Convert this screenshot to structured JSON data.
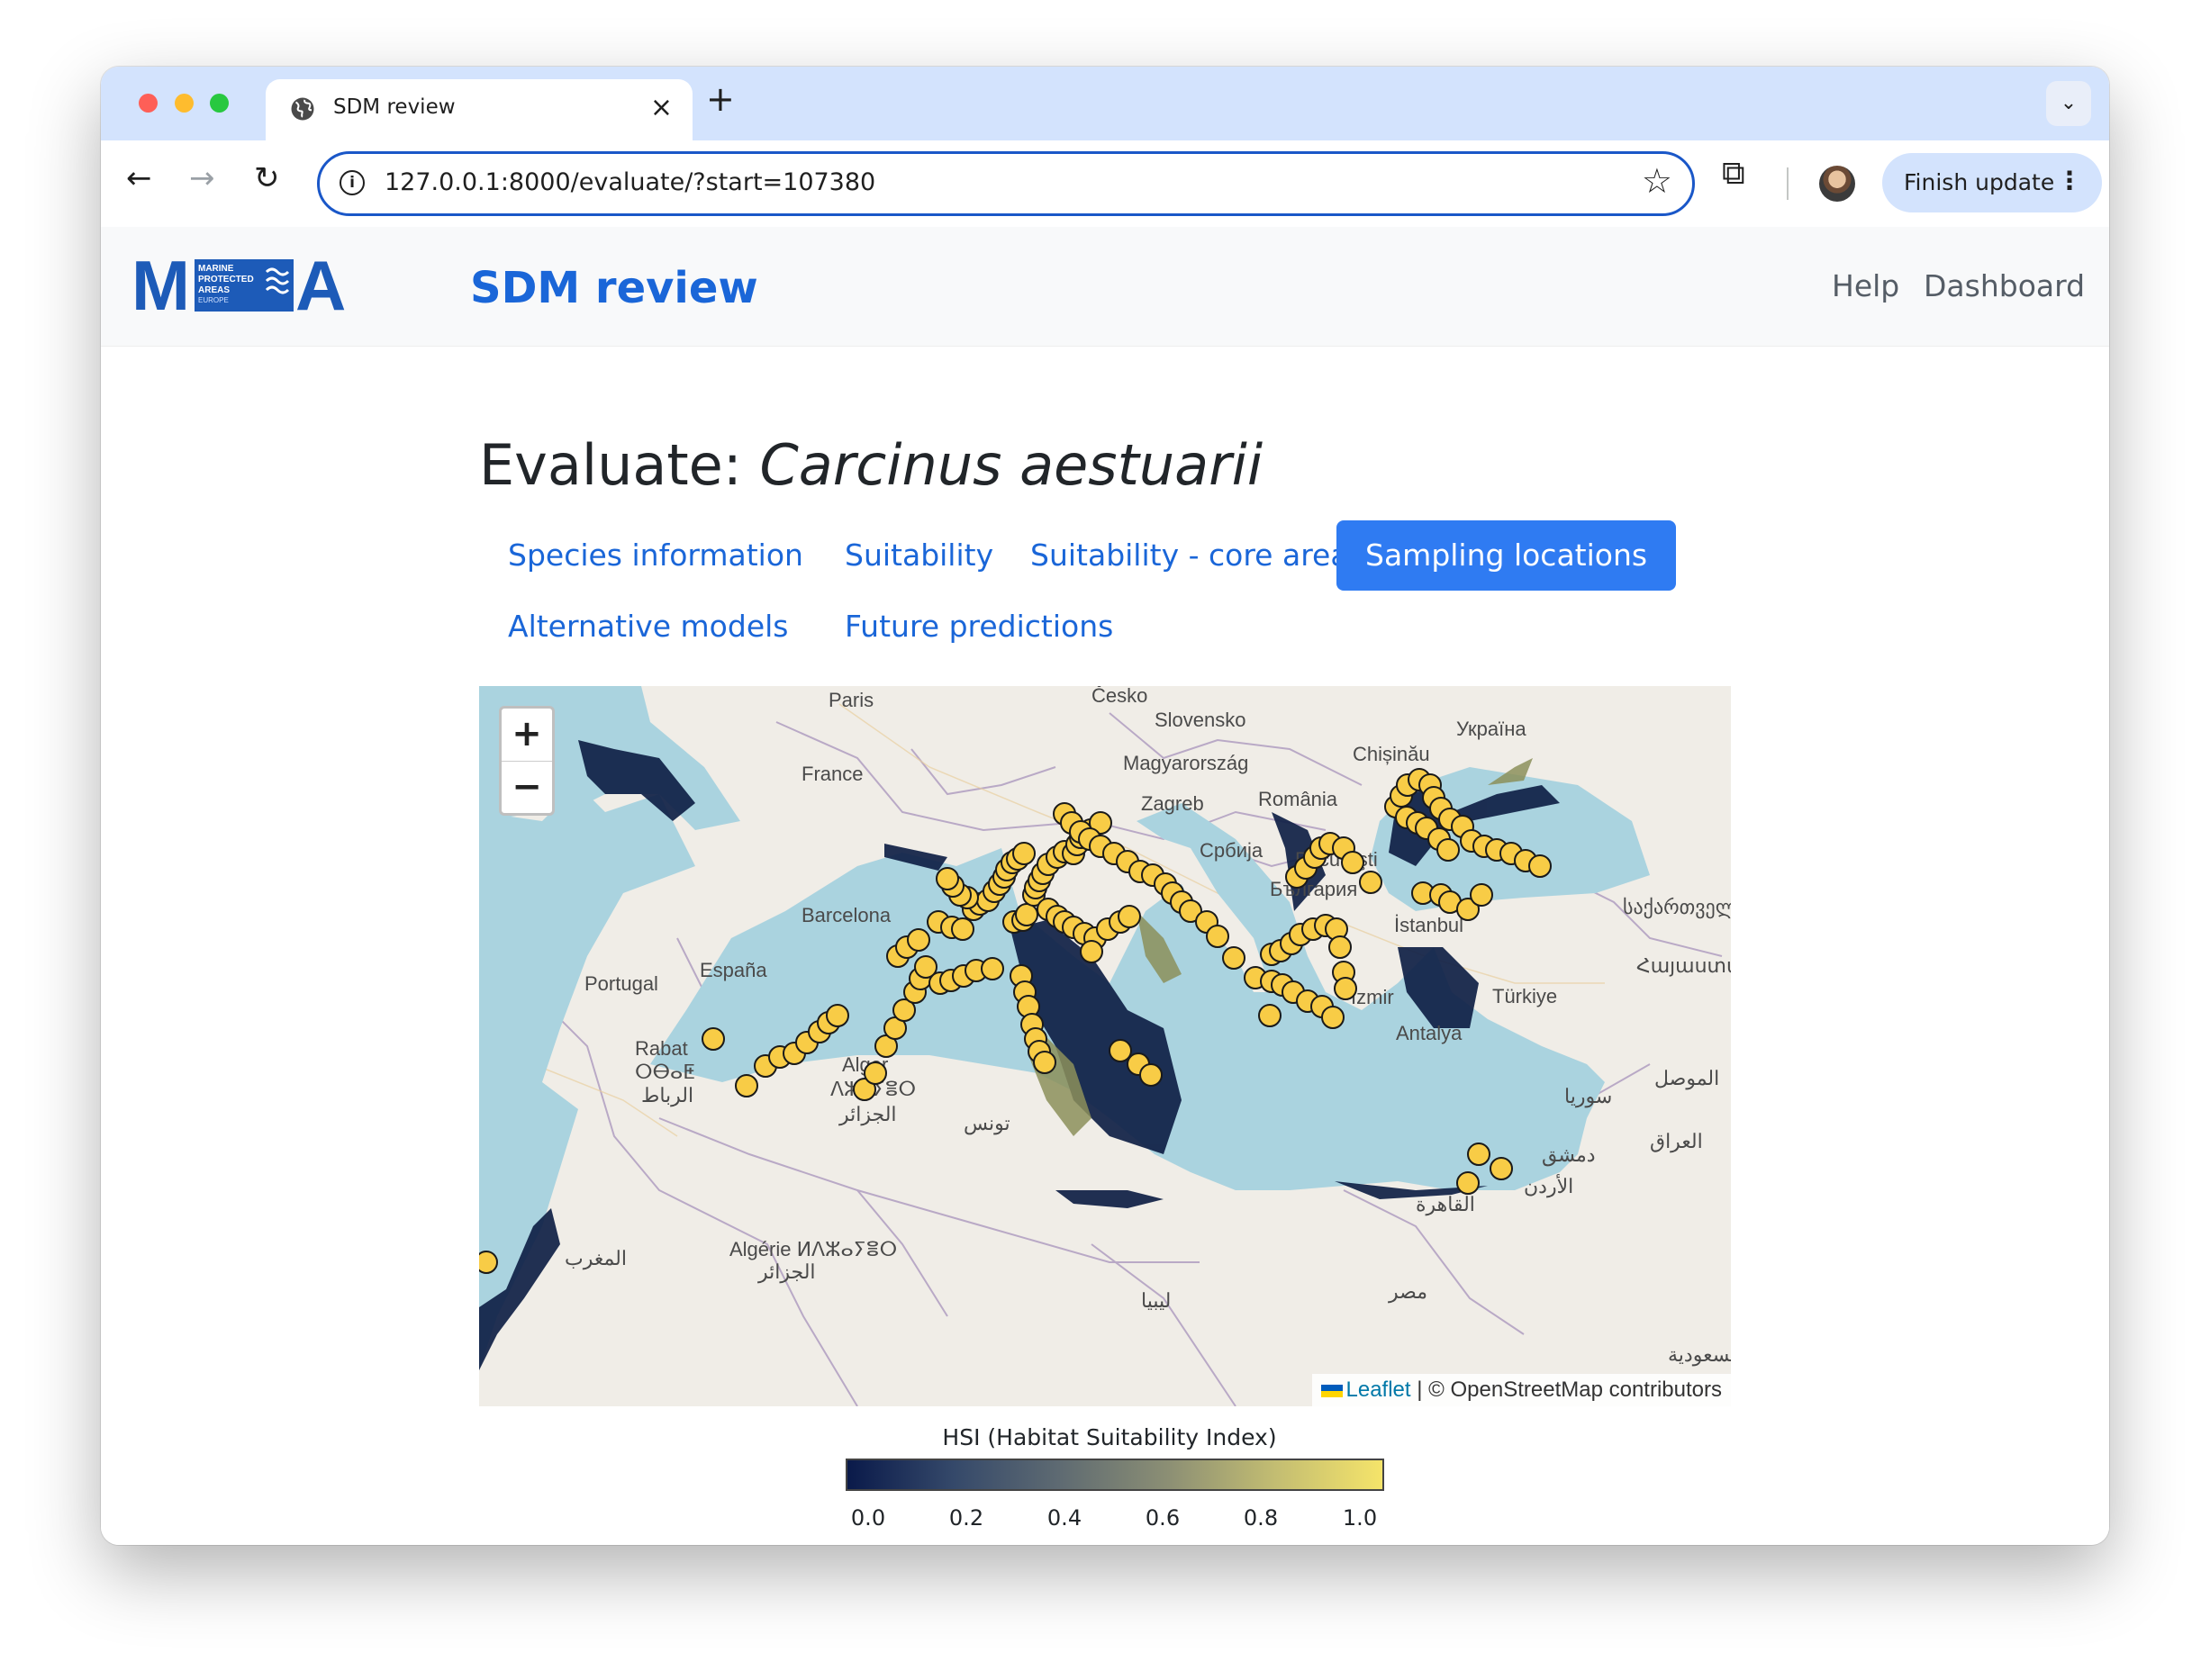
{
  "browser": {
    "tab_title": "SDM review",
    "url": "127.0.0.1:8000/evaluate/?start=107380",
    "finish_update_label": "Finish update",
    "icons": [
      "globe-icon",
      "close-icon",
      "plus-icon",
      "chevron-down-icon",
      "back-icon",
      "forward-icon",
      "reload-icon",
      "info-icon",
      "star-icon",
      "extensions-icon",
      "more-vert-icon"
    ]
  },
  "header": {
    "logo_text": "MPA",
    "logo_subtext": [
      "MARINE",
      "PROTECTED",
      "AREAS",
      "EUROPE"
    ],
    "brand": "SDM review",
    "links": [
      "Help",
      "Dashboard"
    ]
  },
  "main": {
    "heading_prefix": "Evaluate: ",
    "species": "Carcinus aestuarii",
    "tabs": [
      {
        "label": "Species information",
        "active": false
      },
      {
        "label": "Suitability",
        "active": false
      },
      {
        "label": "Suitability - core area",
        "active": false
      },
      {
        "label": "Sampling locations",
        "active": true
      },
      {
        "label": "Alternative models",
        "active": false
      },
      {
        "label": "Future predictions",
        "active": false
      }
    ]
  },
  "map": {
    "zoom_in": "+",
    "zoom_out": "−",
    "attribution_leaflet": "Leaflet",
    "attribution_rest": " | © OpenStreetMap contributors",
    "place_labels": [
      "Paris",
      "France",
      "Česko",
      "Slovensko",
      "Magyarország",
      "Україна",
      "Chișinău",
      "Zagreb",
      "România",
      "Србија",
      "Bucureşti",
      "България",
      "Barcelona",
      "España",
      "Portugal",
      "Rabat",
      "ⵔⴱⴰⵟ",
      "الرباط",
      "Alger",
      "ⴷⵣⴰⵢⴻⵔ",
      "الجزائر",
      "تونس",
      "Türkiye",
      "Antalya",
      "İstanbul",
      "İzmir",
      "საქართველო",
      "Հայաստան",
      "سوريا",
      "الموصل",
      "العراق",
      "دمشق",
      "الأردن",
      "القاهرة",
      "مصر",
      "ليبيا",
      "Algérie ⵍⴷⵣⴰⵢⴻⵔ",
      "الجزائر",
      "المغرب",
      "السعودية"
    ],
    "colors": {
      "sea": "#aad3df",
      "land": "#f0ede7",
      "marker_fill": "#f8cc46",
      "marker_stroke": "#1a1a1a",
      "hsi_dark": "#0f1f45"
    }
  },
  "legend": {
    "title": "HSI (Habitat Suitability Index)",
    "ticks": [
      "0.0",
      "0.2",
      "0.4",
      "0.6",
      "0.8",
      "1.0"
    ],
    "tick_values": [
      0.0,
      0.2,
      0.4,
      0.6,
      0.8,
      1.0
    ],
    "range": [
      0,
      1
    ]
  }
}
